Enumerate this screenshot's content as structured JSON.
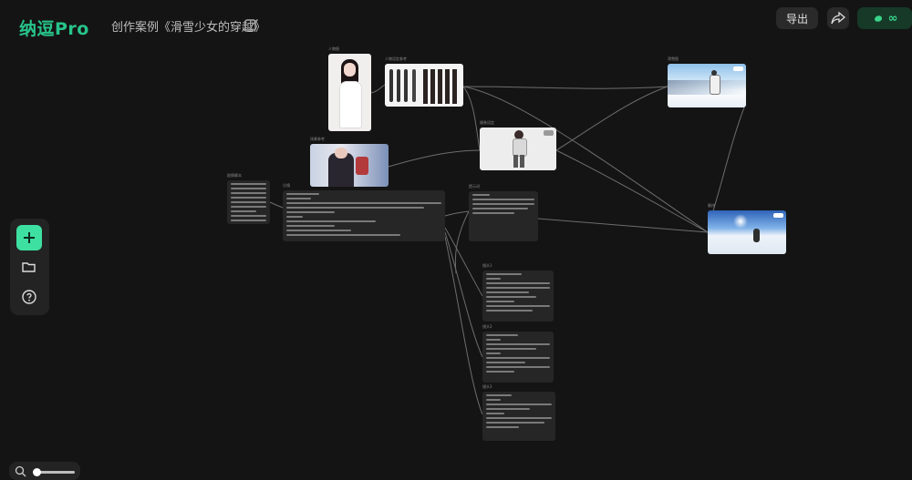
{
  "header": {
    "logo": "纳逗Pro",
    "project_title": "创作案例《滑雪少女的穿越》",
    "export_label": "导出",
    "credits_label": "∞"
  },
  "canvas": {
    "nodes": {
      "portrait": "人物图",
      "character_sheet": "人物设定参考",
      "scene_ref": "场景参考",
      "outfit": "服装设定",
      "result_top": "滑雪图",
      "result_bottom": "最终",
      "story_left": "剧情脚本",
      "script_main": "分镜",
      "prompt_right": "提示词",
      "shot1": "镜头1",
      "shot2": "镜头2",
      "shot3": "镜头3"
    }
  },
  "colors": {
    "accent": "#27c48a",
    "add_button": "#3ee0a2",
    "background": "#141414"
  },
  "icons": [
    "edit-icon",
    "share-icon",
    "infinity-credits-icon",
    "plus-icon",
    "folder-icon",
    "help-icon",
    "zoom-icon"
  ]
}
